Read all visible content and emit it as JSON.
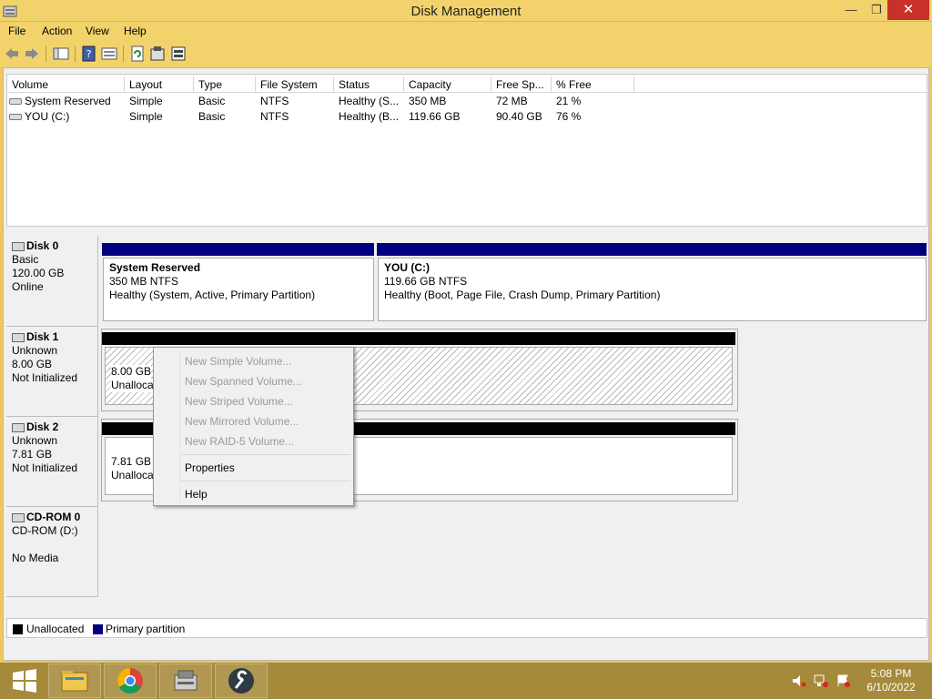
{
  "window": {
    "title": "Disk Management",
    "min_glyph": "—",
    "max_glyph": "❐",
    "close_glyph": "✕"
  },
  "menu": [
    "File",
    "Action",
    "View",
    "Help"
  ],
  "toolbar_icons": [
    "back-icon",
    "forward-icon",
    "console-tree-icon",
    "help-icon",
    "properties-icon",
    "refresh-icon",
    "rescan-icon",
    "settings-icon"
  ],
  "volume_list": {
    "columns": [
      "Volume",
      "Layout",
      "Type",
      "File System",
      "Status",
      "Capacity",
      "Free Sp...",
      "% Free"
    ],
    "rows": [
      [
        "System Reserved",
        "Simple",
        "Basic",
        "NTFS",
        "Healthy (S...",
        "350 MB",
        "72 MB",
        "21 %"
      ],
      [
        "YOU (C:)",
        "Simple",
        "Basic",
        "NTFS",
        "Healthy (B...",
        "119.66 GB",
        "90.40 GB",
        "76 %"
      ]
    ]
  },
  "disks": [
    {
      "name": "Disk 0",
      "type": "Basic",
      "size": "120.00 GB",
      "state": "Online",
      "partitions": [
        {
          "name": "System Reserved",
          "size": "350 MB NTFS",
          "status": "Healthy (System, Active, Primary Partition)"
        },
        {
          "name": "YOU  (C:)",
          "size": "119.66 GB NTFS",
          "status": "Healthy (Boot, Page File, Crash Dump, Primary Partition)"
        }
      ]
    },
    {
      "name": "Disk 1",
      "type": "Unknown",
      "size": "8.00 GB",
      "state": "Not Initialized",
      "partitions": [
        {
          "size": "8.00 GB",
          "status": "Unallocated"
        }
      ]
    },
    {
      "name": "Disk 2",
      "type": "Unknown",
      "size": "7.81 GB",
      "state": "Not Initialized",
      "partitions": [
        {
          "size": "7.81 GB",
          "status": "Unallocated"
        }
      ]
    },
    {
      "name": "CD-ROM 0",
      "type": "CD-ROM (D:)",
      "size": "",
      "state": "No Media"
    }
  ],
  "legend": [
    {
      "label": "Unallocated",
      "color": "#000000"
    },
    {
      "label": "Primary partition",
      "color": "#00007f"
    }
  ],
  "context_menu": {
    "items": [
      {
        "label": "New Simple Volume...",
        "enabled": false
      },
      {
        "label": "New Spanned Volume...",
        "enabled": false
      },
      {
        "label": "New Striped Volume...",
        "enabled": false
      },
      {
        "label": "New Mirrored Volume...",
        "enabled": false
      },
      {
        "label": "New RAID-5 Volume...",
        "enabled": false
      },
      {
        "label": "Properties",
        "enabled": true
      },
      {
        "label": "Help",
        "enabled": true
      }
    ]
  },
  "taskbar": {
    "apps": [
      "file-explorer-icon",
      "chrome-icon",
      "disk-tool-icon",
      "settings-tool-icon"
    ],
    "tray_icons": [
      "speaker-muted-icon",
      "network-icon",
      "action-center-icon"
    ],
    "time": "5:08 PM",
    "date": "6/10/2022"
  },
  "colors": {
    "titlebar": "#f2d36b",
    "primary_partition": "#00007f",
    "unallocated": "#000000",
    "close_button": "#c7312a",
    "taskbar": "#a58a3b"
  }
}
